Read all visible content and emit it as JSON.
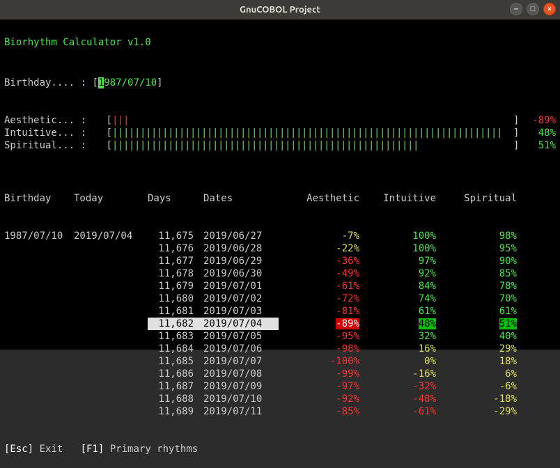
{
  "window": {
    "title": "GnuCOBOL Project",
    "buttons": {
      "min": "–",
      "max": "□",
      "close": "×"
    }
  },
  "app_title": "Biorhythm Calculator v1.0",
  "input": {
    "label": "Birthday.... : ",
    "open": "[",
    "cursor_char": "1",
    "rest": "987/07/10",
    "close": "]"
  },
  "bars": [
    {
      "label": "Aesthetic... : ",
      "filled": 3,
      "total": 70,
      "color": "r",
      "pct": "-89%",
      "pct_color": "red"
    },
    {
      "label": "Intuitive... : ",
      "filled": 70,
      "total": 70,
      "color": "g",
      "pct": "48%",
      "pct_color": "green"
    },
    {
      "label": "Spiritual... : ",
      "filled": 55,
      "total": 70,
      "color": "g",
      "pct": "51%",
      "pct_color": "green"
    }
  ],
  "table": {
    "headers": {
      "birthday": "Birthday",
      "today": "Today",
      "days": "Days",
      "dates": "Dates",
      "aesthetic": "Aesthetic",
      "intuitive": "Intuitive",
      "spiritual": "Spiritual"
    },
    "birthday": "1987/07/10",
    "today": "2019/07/04",
    "rows": [
      {
        "days": "11,675",
        "date": "2019/06/27",
        "a": "-7%",
        "a_c": "yellow",
        "i": "100%",
        "i_c": "green",
        "s": "98%",
        "s_c": "green"
      },
      {
        "days": "11,676",
        "date": "2019/06/28",
        "a": "-22%",
        "a_c": "yellow",
        "i": "100%",
        "i_c": "green",
        "s": "95%",
        "s_c": "green"
      },
      {
        "days": "11,677",
        "date": "2019/06/29",
        "a": "-36%",
        "a_c": "red",
        "i": "97%",
        "i_c": "green",
        "s": "90%",
        "s_c": "green"
      },
      {
        "days": "11,678",
        "date": "2019/06/30",
        "a": "-49%",
        "a_c": "red",
        "i": "92%",
        "i_c": "green",
        "s": "85%",
        "s_c": "green"
      },
      {
        "days": "11,679",
        "date": "2019/07/01",
        "a": "-61%",
        "a_c": "red",
        "i": "84%",
        "i_c": "green",
        "s": "78%",
        "s_c": "green"
      },
      {
        "days": "11,680",
        "date": "2019/07/02",
        "a": "-72%",
        "a_c": "red",
        "i": "74%",
        "i_c": "green",
        "s": "70%",
        "s_c": "green"
      },
      {
        "days": "11,681",
        "date": "2019/07/03",
        "a": "-81%",
        "a_c": "red",
        "i": "61%",
        "i_c": "green",
        "s": "61%",
        "s_c": "green"
      },
      {
        "days": "11,682",
        "date": "2019/07/04",
        "a": "-89%",
        "a_c": "hlred",
        "i": "48%",
        "i_c": "hlgreen",
        "s": "51%",
        "s_c": "hlgreen",
        "selected": true
      },
      {
        "days": "11,683",
        "date": "2019/07/05",
        "a": "-95%",
        "a_c": "red",
        "i": "32%",
        "i_c": "green",
        "s": "40%",
        "s_c": "green"
      },
      {
        "days": "11,684",
        "date": "2019/07/06",
        "a": "-98%",
        "a_c": "red",
        "i": "16%",
        "i_c": "yellow",
        "s": "29%",
        "s_c": "yellow"
      },
      {
        "days": "11,685",
        "date": "2019/07/07",
        "a": "-100%",
        "a_c": "red",
        "i": "0%",
        "i_c": "yellow",
        "s": "18%",
        "s_c": "yellow"
      },
      {
        "days": "11,686",
        "date": "2019/07/08",
        "a": "-99%",
        "a_c": "red",
        "i": "-16%",
        "i_c": "yellow",
        "s": "6%",
        "s_c": "yellow"
      },
      {
        "days": "11,687",
        "date": "2019/07/09",
        "a": "-97%",
        "a_c": "red",
        "i": "-32%",
        "i_c": "red",
        "s": "-6%",
        "s_c": "yellow"
      },
      {
        "days": "11,688",
        "date": "2019/07/10",
        "a": "-92%",
        "a_c": "red",
        "i": "-48%",
        "i_c": "red",
        "s": "-18%",
        "s_c": "yellow"
      },
      {
        "days": "11,689",
        "date": "2019/07/11",
        "a": "-85%",
        "a_c": "red",
        "i": "-61%",
        "i_c": "red",
        "s": "-29%",
        "s_c": "yellow"
      }
    ]
  },
  "footer": {
    "esc_key": "[Esc]",
    "esc_label": " Exit   ",
    "f1_key": "[F1]",
    "f1_label": " Primary rhythms"
  },
  "chart_data": {
    "type": "table",
    "title": "Biorhythm Calculator v1.0",
    "birthday": "1987/07/10",
    "reference_date": "2019/07/04",
    "series": [
      {
        "name": "Aesthetic",
        "values": [
          -7,
          -22,
          -36,
          -49,
          -61,
          -72,
          -81,
          -89,
          -95,
          -98,
          -100,
          -99,
          -97,
          -92,
          -85
        ]
      },
      {
        "name": "Intuitive",
        "values": [
          100,
          100,
          97,
          92,
          84,
          74,
          61,
          48,
          32,
          16,
          0,
          -16,
          -32,
          -48,
          -61
        ]
      },
      {
        "name": "Spiritual",
        "values": [
          98,
          95,
          90,
          85,
          78,
          70,
          61,
          51,
          40,
          29,
          18,
          6,
          -6,
          -18,
          -29
        ]
      }
    ],
    "dates": [
      "2019/06/27",
      "2019/06/28",
      "2019/06/29",
      "2019/06/30",
      "2019/07/01",
      "2019/07/02",
      "2019/07/03",
      "2019/07/04",
      "2019/07/05",
      "2019/07/06",
      "2019/07/07",
      "2019/07/08",
      "2019/07/09",
      "2019/07/10",
      "2019/07/11"
    ],
    "days_alive": [
      11675,
      11676,
      11677,
      11678,
      11679,
      11680,
      11681,
      11682,
      11683,
      11684,
      11685,
      11686,
      11687,
      11688,
      11689
    ],
    "ylim": [
      -100,
      100
    ],
    "ylabel": "%"
  }
}
